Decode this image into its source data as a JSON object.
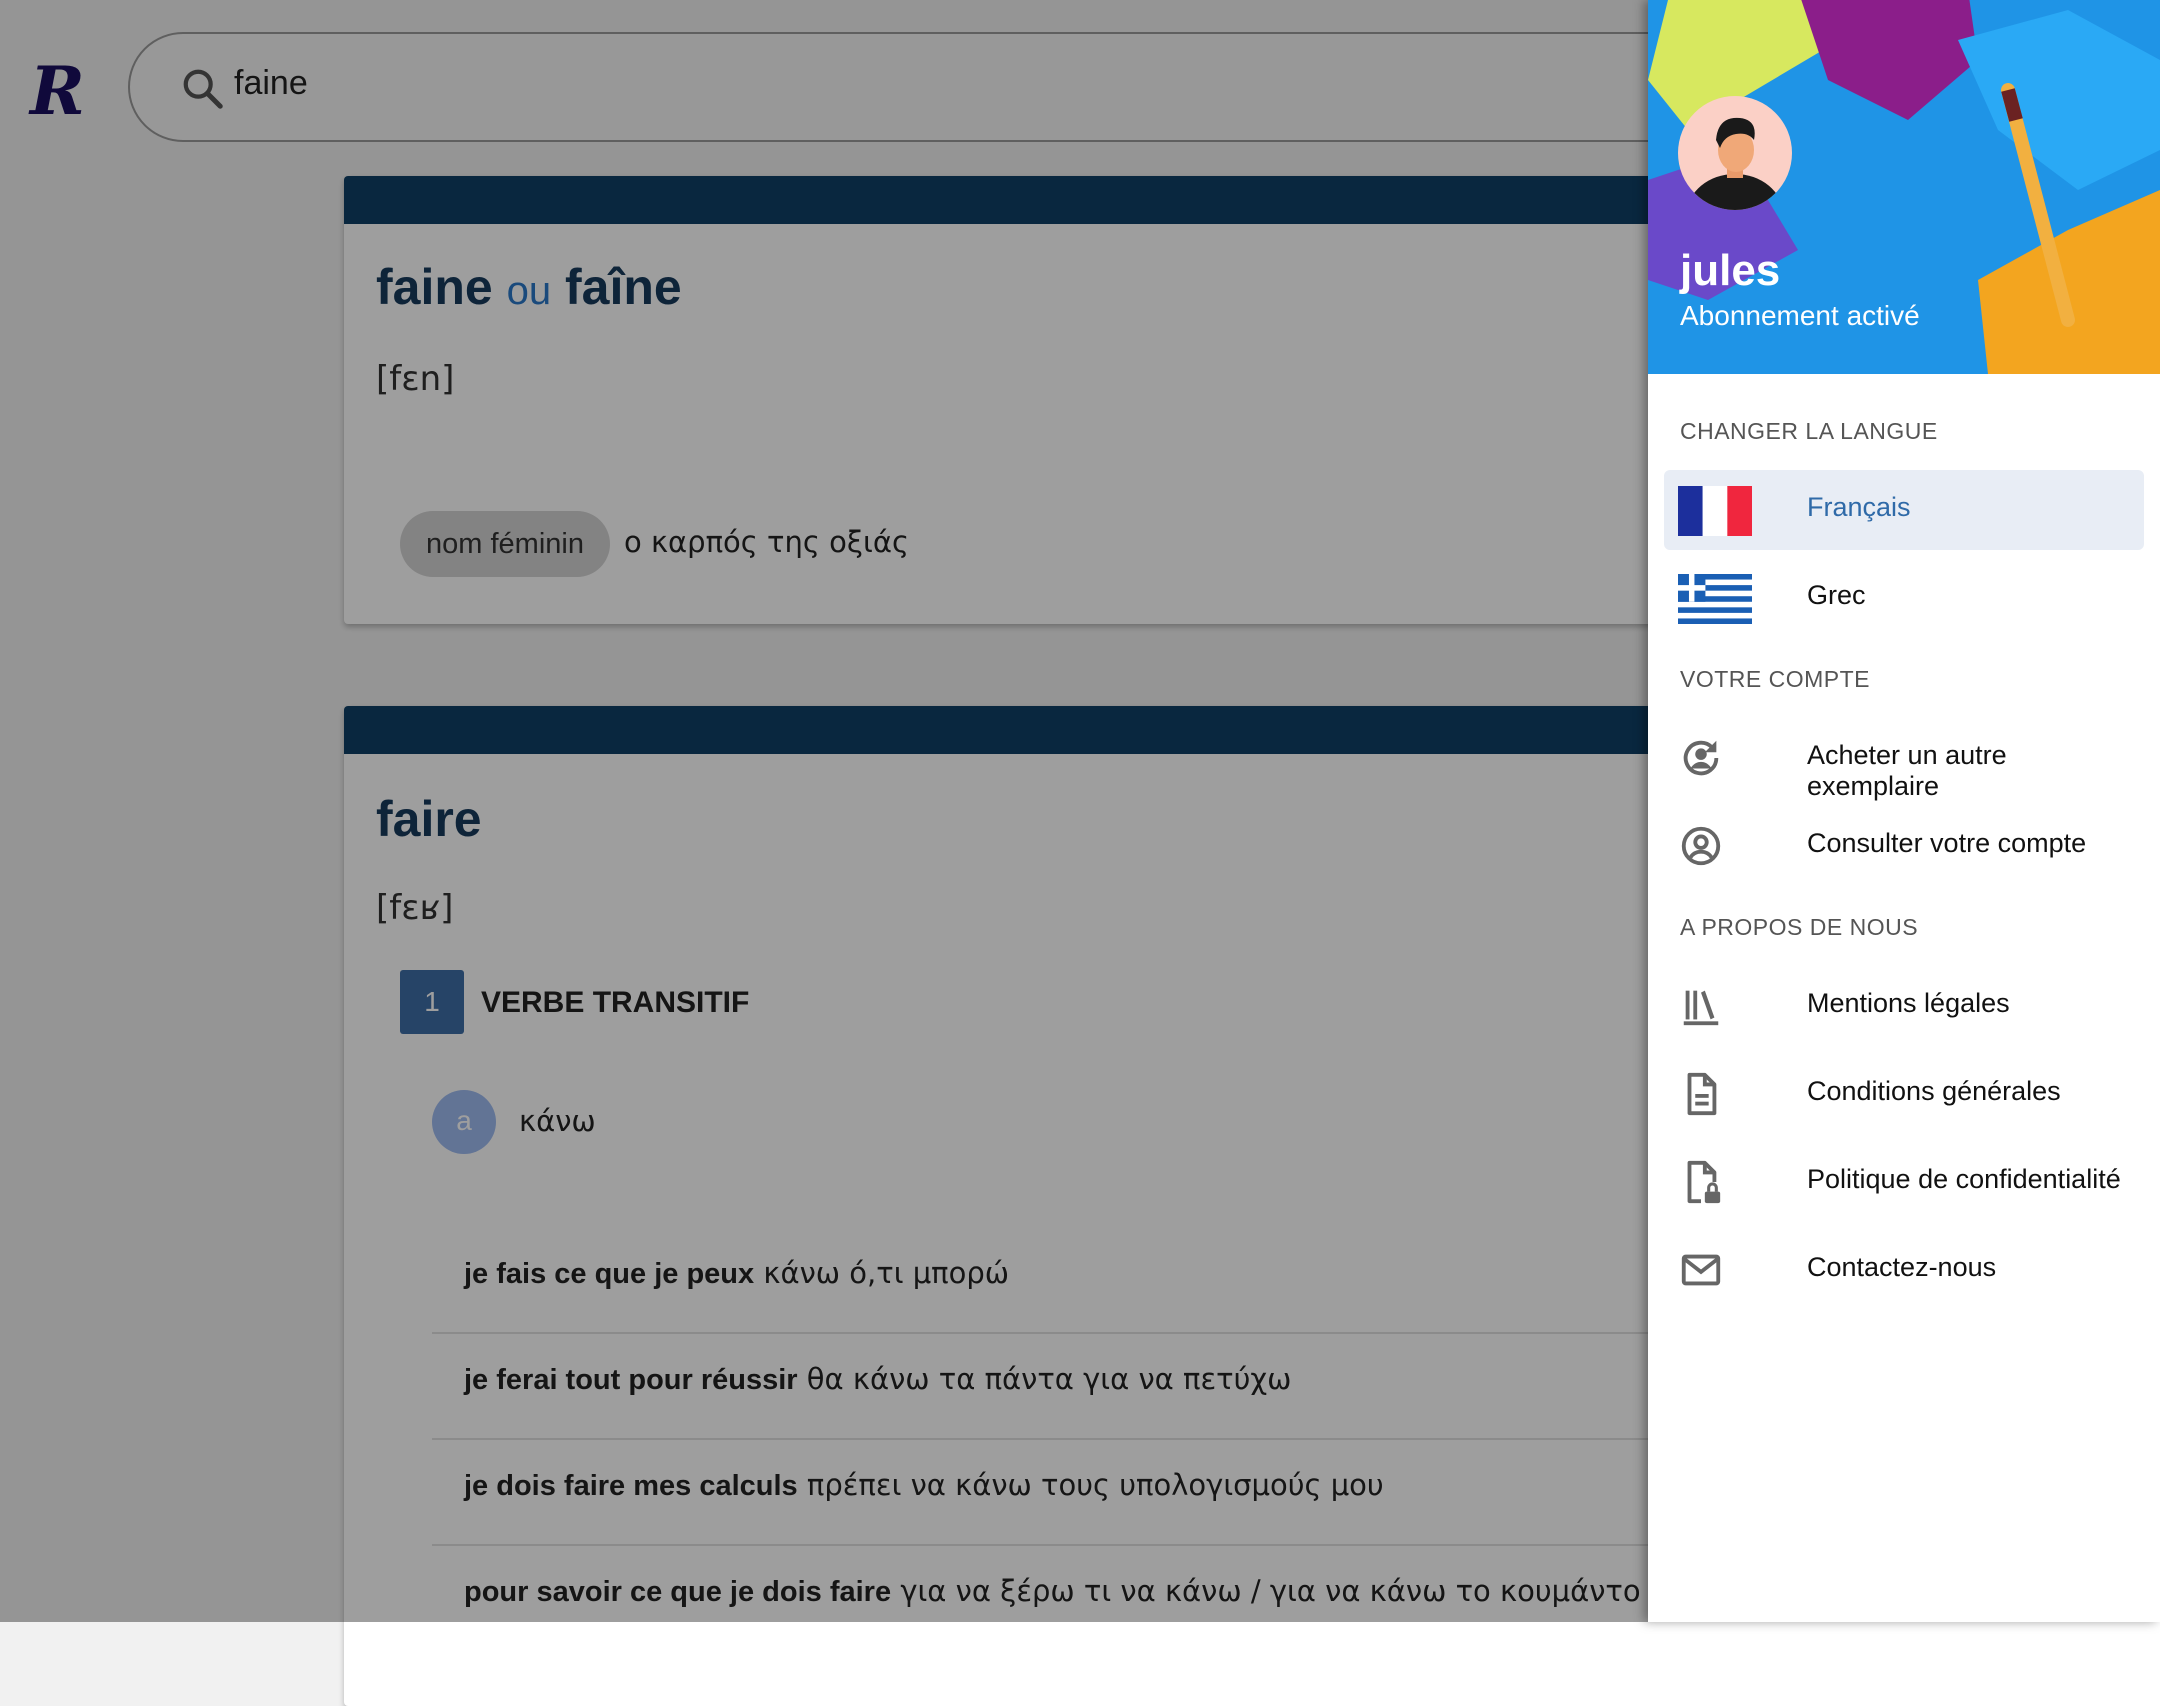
{
  "header": {
    "logo_text": "R",
    "search": {
      "value": "faine",
      "icon": "search-icon"
    }
  },
  "entries": [
    {
      "headword": "faine",
      "connector": "ou",
      "alt_headword": "faîne",
      "phonetic": "[fɛn]",
      "pos": "nom féminin",
      "translation": "ο καρπός της οξιάς"
    },
    {
      "headword": "faire",
      "phonetic": "[fɛʁ]",
      "sense": {
        "number": "1",
        "label": "VERBE TRANSITIF"
      },
      "subsense": {
        "letter": "a",
        "translation": "κάνω"
      },
      "examples": [
        {
          "fr": "je fais ce que je peux",
          "gr": "κάνω ό,τι μπορώ"
        },
        {
          "fr": "je ferai tout pour réussir",
          "gr": "θα κάνω τα πάντα για να πετύχω"
        },
        {
          "fr": "je dois faire mes calculs",
          "gr": "πρέπει να κάνω τους υπολογισμούς μου"
        },
        {
          "fr": "pour savoir ce que je dois faire",
          "gr": "για να ξέρω τι να κάνω / για να κάνω το κουμάντο μου"
        }
      ]
    }
  ],
  "drawer": {
    "user": {
      "name": "jules",
      "status": "Abonnement activé"
    },
    "sections": {
      "language": "CHANGER LA LANGUE",
      "account": "VOTRE COMPTE",
      "about": "A PROPOS DE NOUS"
    },
    "languages": [
      {
        "label": "Français",
        "selected": true,
        "icon": "france-flag-icon"
      },
      {
        "label": "Grec",
        "selected": false,
        "icon": "greece-flag-icon"
      }
    ],
    "account_items": [
      {
        "label": "Acheter un autre exemplaire",
        "icon": "refresh-user-icon"
      },
      {
        "label": "Consulter votre compte",
        "icon": "account-circle-icon"
      }
    ],
    "about_items": [
      {
        "label": "Mentions légales",
        "icon": "library-icon"
      },
      {
        "label": "Conditions générales",
        "icon": "document-icon"
      },
      {
        "label": "Politique de confidentialité",
        "icon": "document-lock-icon"
      },
      {
        "label": "Contactez-nous",
        "icon": "mail-icon"
      }
    ],
    "colors": {
      "accent": "#2f6aa8",
      "header_bg": "#1f94e6",
      "card_bar": "#0f3f66"
    }
  }
}
